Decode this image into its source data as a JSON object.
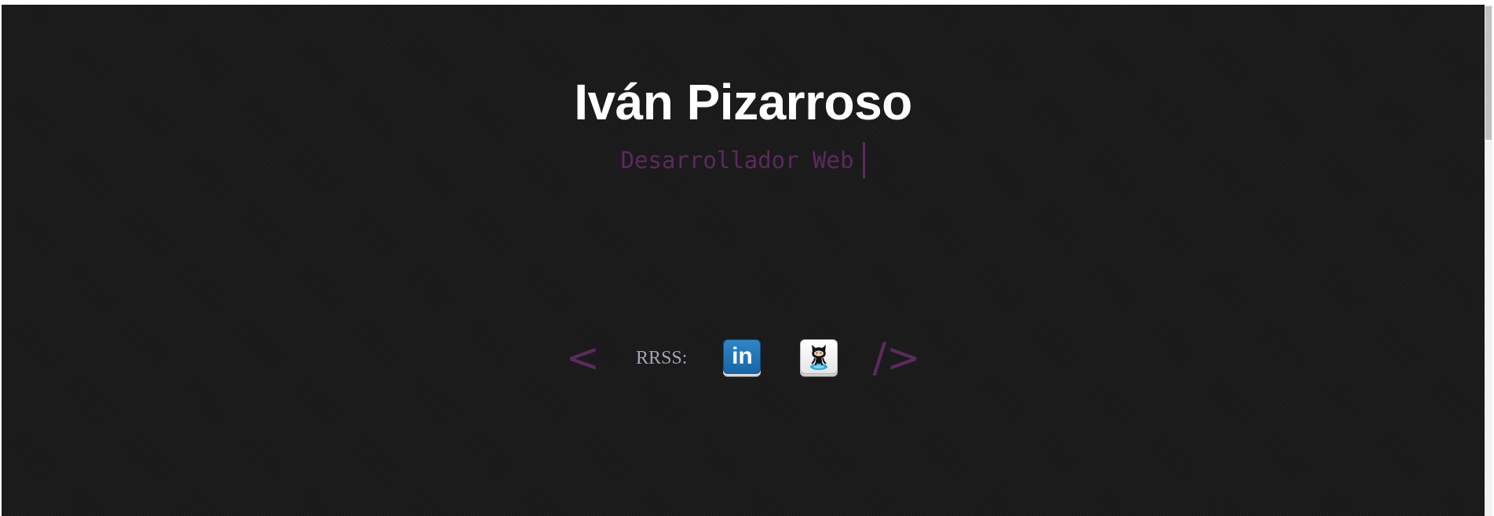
{
  "header": {
    "name": "Iván Pizarroso",
    "role": "Desarrollador Web"
  },
  "social": {
    "open_bracket": "<",
    "label": "RRSS:",
    "close_bracket": "/>",
    "links": [
      {
        "name": "linkedin",
        "icon": "linkedin-icon",
        "text": "in"
      },
      {
        "name": "github",
        "icon": "github-octocat-icon"
      }
    ]
  },
  "colors": {
    "background": "#1b1b1b",
    "accent": "#5c2a5e",
    "title": "#ffffff",
    "label": "#a4a4b8"
  }
}
